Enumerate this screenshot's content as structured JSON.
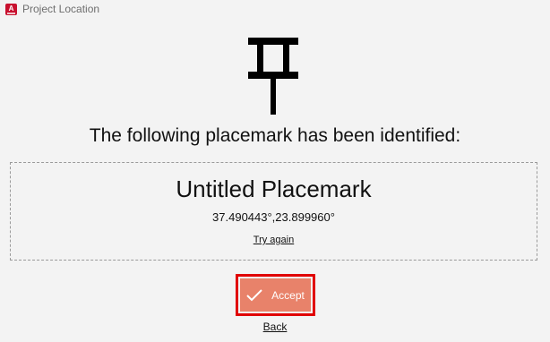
{
  "window": {
    "title": "Project Location",
    "app_icon": "autodesk-app-icon",
    "app_icon_letter": "A"
  },
  "pin_icon": "pushpin-icon",
  "heading": "The following placemark has been identified:",
  "placemark": {
    "name": "Untitled Placemark",
    "coordinates": "37.490443°,23.899960°",
    "try_again_label": "Try again"
  },
  "actions": {
    "accept_label": "Accept",
    "accept_icon": "checkmark-icon",
    "back_label": "Back"
  },
  "colors": {
    "accept_bg": "#e8826a",
    "highlight_border": "#e00000",
    "background": "#f3f3f3"
  }
}
